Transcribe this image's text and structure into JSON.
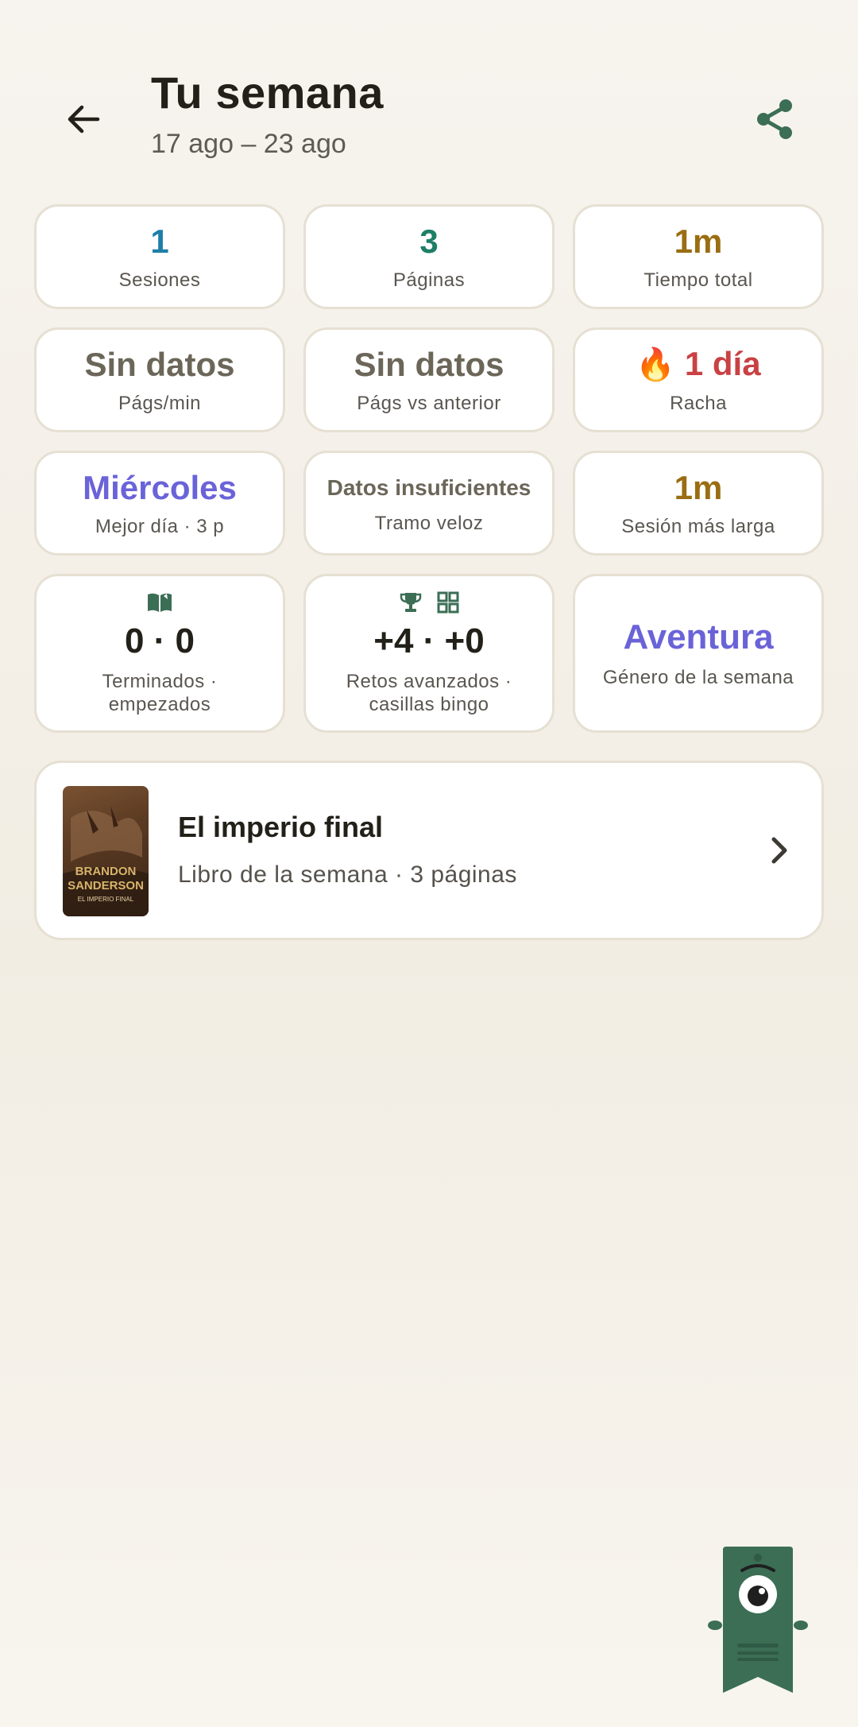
{
  "header": {
    "title": "Tu semana",
    "date_range": "17 ago – 23 ago"
  },
  "stats": [
    {
      "value": "1",
      "label": "Sesiones",
      "color": "#1f7fa8"
    },
    {
      "value": "3",
      "label": "Páginas",
      "color": "#1d7f66"
    },
    {
      "value": "1m",
      "label": "Tiempo total",
      "color": "#9a6d12"
    },
    {
      "value": "Sin datos",
      "label": "Págs/min",
      "color": "#6b6658"
    },
    {
      "value": "Sin datos",
      "label": "Págs vs anterior",
      "color": "#6b6658"
    },
    {
      "value": "1 día",
      "label": "Racha",
      "color": "#c94144",
      "emoji": "🔥"
    },
    {
      "value": "Miércoles",
      "label": "Mejor día · 3 p",
      "color": "#6a63d8"
    },
    {
      "value": "Datos insuficientes",
      "label": "Tramo veloz",
      "color": "#6b6658"
    },
    {
      "value": "1m",
      "label": "Sesión más larga",
      "color": "#9a6d12"
    },
    {
      "value": "0 · 0",
      "label_line1": "Terminados ·",
      "label_line2": "empezados",
      "color": "#222018",
      "icon": "open-book-icon"
    },
    {
      "value": "+4 · +0",
      "label_line1": "Retos avanzados ·",
      "label_line2": "casillas bingo",
      "color": "#222018",
      "icons": [
        "trophy-icon",
        "grid-icon"
      ]
    },
    {
      "value": "Aventura",
      "label": "Género de la semana",
      "color": "#6a63d8"
    }
  ],
  "book_of_week": {
    "title": "El imperio final",
    "subtitle": "Libro de la semana · 3 páginas",
    "cover_author": "BRANDON SANDERSON",
    "cover_title": "EL IMPERIO FINAL"
  },
  "colors": {
    "accent_green": "#3b6e55",
    "border": "#e6e0d3"
  }
}
